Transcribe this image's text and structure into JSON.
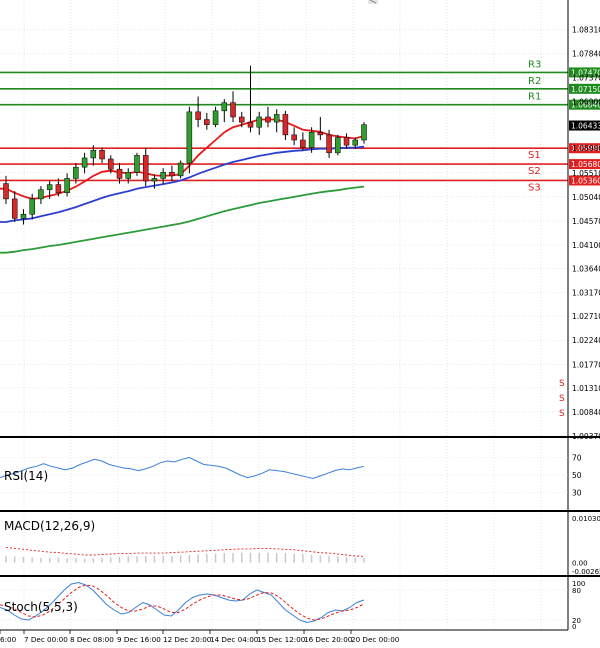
{
  "chart_data": [
    {
      "type": "candlestick",
      "panel": "price",
      "y_ticks": [
        "1.08310",
        "1.07840",
        "1.07370",
        "1.06900",
        "1.06433",
        "1.05990",
        "1.05510",
        "1.05040",
        "1.04570",
        "1.04100",
        "1.03640",
        "1.03170",
        "1.02710",
        "1.02240",
        "1.01770",
        "1.01310",
        "1.00840",
        "1.00370"
      ],
      "ylim": [
        1.0037,
        1.0865
      ],
      "price_tag": {
        "text": "1.06433",
        "value": 1.06433,
        "color": "#000000"
      },
      "levels": [
        {
          "label": "R3",
          "value": 1.0747,
          "tag": "1.07470",
          "color": "#1f8b1f"
        },
        {
          "label": "R2",
          "value": 1.0715,
          "tag": "1.07150",
          "color": "#1f8b1f"
        },
        {
          "label": "R1",
          "value": 1.0684,
          "tag": "1.06840",
          "color": "#1f8b1f"
        },
        {
          "label": "S1",
          "value": 1.0599,
          "tag": "1.05990",
          "color": "#e02020"
        },
        {
          "label": "S2",
          "value": 1.0568,
          "tag": "1.05680",
          "color": "#e02020"
        },
        {
          "label": "S3",
          "value": 1.0536,
          "tag": "1.05360",
          "color": "#e02020"
        }
      ],
      "right_marks": [
        "S",
        "S",
        "S"
      ],
      "candles": [
        [
          1.053,
          1.0545,
          1.049,
          1.05
        ],
        [
          1.05,
          1.0515,
          1.0455,
          1.0462
        ],
        [
          1.0462,
          1.048,
          1.045,
          1.047
        ],
        [
          1.047,
          1.051,
          1.046,
          1.05
        ],
        [
          1.05,
          1.0525,
          1.049,
          1.0518
        ],
        [
          1.0518,
          1.0535,
          1.05,
          1.0528
        ],
        [
          1.0528,
          1.054,
          1.0505,
          1.0512
        ],
        [
          1.0512,
          1.055,
          1.0505,
          1.054
        ],
        [
          1.054,
          1.057,
          1.053,
          1.0562
        ],
        [
          1.0562,
          1.059,
          1.055,
          1.058
        ],
        [
          1.058,
          1.0605,
          1.0565,
          1.0595
        ],
        [
          1.0595,
          1.06,
          1.057,
          1.0578
        ],
        [
          1.0578,
          1.0585,
          1.055,
          1.0558
        ],
        [
          1.0558,
          1.057,
          1.053,
          1.054
        ],
        [
          1.054,
          1.056,
          1.053,
          1.0552
        ],
        [
          1.0552,
          1.059,
          1.0545,
          1.0585
        ],
        [
          1.0585,
          1.06,
          1.0525,
          1.0535
        ],
        [
          1.0535,
          1.0548,
          1.052,
          1.054
        ],
        [
          1.054,
          1.056,
          1.053,
          1.0552
        ],
        [
          1.0552,
          1.0565,
          1.0535,
          1.0545
        ],
        [
          1.0545,
          1.0575,
          1.054,
          1.057
        ],
        [
          1.057,
          1.068,
          1.055,
          1.067
        ],
        [
          1.067,
          1.07,
          1.064,
          1.0655
        ],
        [
          1.0655,
          1.0668,
          1.0635,
          1.0645
        ],
        [
          1.0645,
          1.068,
          1.064,
          1.0672
        ],
        [
          1.0672,
          1.0695,
          1.065,
          1.0688
        ],
        [
          1.0688,
          1.071,
          1.065,
          1.066
        ],
        [
          1.066,
          1.067,
          1.064,
          1.065
        ],
        [
          1.065,
          1.076,
          1.063,
          1.064
        ],
        [
          1.064,
          1.067,
          1.0625,
          1.066
        ],
        [
          1.066,
          1.068,
          1.064,
          1.065
        ],
        [
          1.065,
          1.0675,
          1.063,
          1.0665
        ],
        [
          1.0665,
          1.0672,
          1.0615,
          1.0625
        ],
        [
          1.0625,
          1.064,
          1.0605,
          1.0615
        ],
        [
          1.0615,
          1.063,
          1.0595,
          1.06
        ],
        [
          1.06,
          1.064,
          1.059,
          1.063
        ],
        [
          1.063,
          1.066,
          1.0615,
          1.0625
        ],
        [
          1.0625,
          1.0635,
          1.058,
          1.059
        ],
        [
          1.059,
          1.0625,
          1.0585,
          1.062
        ],
        [
          1.062,
          1.0628,
          1.0598,
          1.0605
        ],
        [
          1.0605,
          1.062,
          1.0598,
          1.0615
        ],
        [
          1.0615,
          1.065,
          1.0608,
          1.0645
        ]
      ],
      "series": [
        {
          "name": "",
          "color": "#e8171a",
          "values": [
            1.052,
            1.0512,
            1.0505,
            1.05,
            1.0502,
            1.0506,
            1.051,
            1.0516,
            1.0524,
            1.0534,
            1.0545,
            1.0553,
            1.0555,
            1.0552,
            1.055,
            1.0553,
            1.055,
            1.0546,
            1.0545,
            1.0546,
            1.0548,
            1.0565,
            1.0585,
            1.06,
            1.0615,
            1.063,
            1.064,
            1.0645,
            1.065,
            1.0655,
            1.0655,
            1.0655,
            1.065,
            1.0643,
            1.0635,
            1.0633,
            1.0631,
            1.0625,
            1.0622,
            1.062,
            1.0618,
            1.0623
          ]
        },
        {
          "name": "",
          "color": "#2b3fd0",
          "values": [
            1.0455,
            1.0458,
            1.046,
            1.0462,
            1.0466,
            1.047,
            1.0474,
            1.0479,
            1.0484,
            1.049,
            1.0496,
            1.0502,
            1.0507,
            1.0511,
            1.0515,
            1.052,
            1.0523,
            1.0526,
            1.0529,
            1.0532,
            1.0536,
            1.0542,
            1.0549,
            1.0555,
            1.0561,
            1.0567,
            1.0572,
            1.0576,
            1.058,
            1.0584,
            1.0587,
            1.059,
            1.0592,
            1.0594,
            1.0595,
            1.0597,
            1.0598,
            1.0598,
            1.0599,
            1.06,
            1.06,
            1.0602
          ]
        },
        {
          "name": "",
          "color": "#2c9b3a",
          "values": [
            1.0395,
            1.0397,
            1.04,
            1.0402,
            1.0405,
            1.0408,
            1.041,
            1.0413,
            1.0416,
            1.0419,
            1.0422,
            1.0425,
            1.0428,
            1.0431,
            1.0434,
            1.0437,
            1.044,
            1.0443,
            1.0446,
            1.0449,
            1.0452,
            1.0456,
            1.0461,
            1.0466,
            1.0471,
            1.0476,
            1.048,
            1.0484,
            1.0488,
            1.0492,
            1.0495,
            1.0498,
            1.0501,
            1.0504,
            1.0507,
            1.051,
            1.0513,
            1.0515,
            1.0517,
            1.052,
            1.0522,
            1.0524
          ]
        }
      ],
      "colors": {
        "bull_body": "#2f9e2f",
        "bear_body": "#d42a2a",
        "wick": "#000000"
      }
    },
    {
      "type": "line",
      "panel": "rsi",
      "title": "RSI(14)",
      "y_ticks": [
        "70",
        "50",
        "30"
      ],
      "ylim": [
        10,
        90
      ],
      "series": [
        {
          "name": "",
          "color": "#3b7fd9",
          "values": [
            47,
            50,
            52,
            55,
            58,
            60,
            63,
            60,
            58,
            56,
            58,
            62,
            65,
            68,
            66,
            62,
            60,
            58,
            57,
            55,
            57,
            60,
            64,
            66,
            65,
            68,
            70,
            66,
            62,
            61,
            60,
            58,
            54,
            50,
            47,
            49,
            52,
            56,
            55,
            54,
            52,
            50,
            48,
            46,
            49,
            52,
            55,
            57,
            56,
            58,
            60
          ]
        }
      ]
    },
    {
      "type": "bar",
      "panel": "macd",
      "title": "MACD(12,26,9)",
      "y_ticks": [
        "0.010307",
        "0.00",
        "-0.00265"
      ],
      "ylim": [
        -0.00265,
        0.010307
      ],
      "histogram": [
        0.0014,
        0.0013,
        0.0012,
        0.0011,
        0.001,
        0.001,
        0.001,
        0.0009,
        0.0009,
        0.0008,
        0.0009,
        0.001,
        0.0011,
        0.0012,
        0.0013,
        0.0013,
        0.0014,
        0.0014,
        0.0014,
        0.0014,
        0.0015,
        0.0016,
        0.0017,
        0.0018,
        0.0019,
        0.002,
        0.002,
        0.0021,
        0.0021,
        0.0021,
        0.0021,
        0.002,
        0.002,
        0.0019,
        0.0018,
        0.0016,
        0.0015,
        0.0014,
        0.0013,
        0.0012,
        0.0011,
        0.001
      ],
      "series": [
        {
          "name": "",
          "color": "#e02020",
          "values": [
            0.0032,
            0.003,
            0.0028,
            0.0026,
            0.0024,
            0.0022,
            0.0021,
            0.0019,
            0.0018,
            0.0016,
            0.0016,
            0.0017,
            0.0018,
            0.0019,
            0.0019,
            0.002,
            0.002,
            0.002,
            0.002,
            0.0021,
            0.0022,
            0.0023,
            0.0024,
            0.0025,
            0.0026,
            0.0027,
            0.0028,
            0.0029,
            0.0029,
            0.003,
            0.003,
            0.0029,
            0.0028,
            0.0027,
            0.0025,
            0.0023,
            0.0021,
            0.002,
            0.0018,
            0.0016,
            0.0014,
            0.0013
          ]
        }
      ],
      "hist_color": "#c6c6c6"
    },
    {
      "type": "line",
      "panel": "stoch",
      "title": "Stoch(5,5,3)",
      "y_ticks": [
        "100",
        "80",
        "20",
        "0"
      ],
      "ylim": [
        0,
        100
      ],
      "series": [
        {
          "name": "",
          "color": "#3b7fd9",
          "values": [
            45,
            40,
            30,
            22,
            20,
            28,
            38,
            50,
            65,
            80,
            92,
            95,
            90,
            80,
            65,
            50,
            40,
            32,
            35,
            45,
            55,
            50,
            40,
            30,
            28,
            40,
            55,
            65,
            70,
            72,
            70,
            65,
            60,
            58,
            60,
            72,
            80,
            75,
            70,
            55,
            40,
            30,
            20,
            15,
            18,
            25,
            35,
            40,
            38,
            45,
            55,
            60
          ]
        },
        {
          "name": "",
          "color": "#e02020",
          "values": [
            50,
            48,
            42,
            35,
            28,
            26,
            30,
            38,
            50,
            62,
            75,
            85,
            90,
            88,
            80,
            68,
            55,
            45,
            38,
            38,
            42,
            48,
            48,
            42,
            35,
            35,
            42,
            52,
            60,
            66,
            70,
            70,
            66,
            62,
            60,
            63,
            70,
            75,
            74,
            67,
            55,
            43,
            32,
            24,
            20,
            22,
            28,
            34,
            38,
            40,
            45,
            52
          ]
        }
      ]
    }
  ],
  "x_ticks": [
    "6:00",
    "7 Dec 00:00",
    "8 Dec 08:00",
    "9 Dec 16:00",
    "12 Dec 20:00",
    "14 Dec 04:00",
    "15 Dec 12:00",
    "16 Dec 20:00",
    "20 Dec 00:00"
  ],
  "grid": true
}
